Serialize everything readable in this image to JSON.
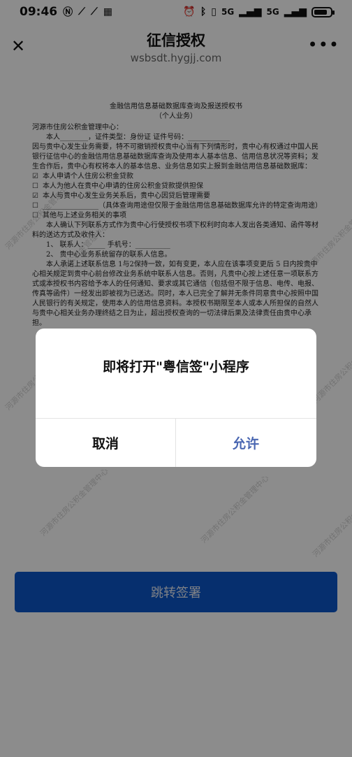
{
  "status_bar": {
    "time": "09:46",
    "left_icons": [
      "nfc-icon",
      "signal-app-icon",
      "signal-app-icon",
      "calendar-icon"
    ],
    "signal_1": "5G",
    "signal_2": "5G",
    "battery_level": 0.8
  },
  "nav": {
    "title": "征信授权",
    "url": "wsbsdt.hygjj.com"
  },
  "document": {
    "title": "金融信用信息基础数据库查询及报送授权书",
    "subtitle": "（个人业务）",
    "greeting": "河源市住房公积金管理中心：",
    "line_id": "本人________，证件类型：身份证  证件号码：____________",
    "paragraph_1": "因与贵中心发生业务需要，特不可撤销授权贵中心当有下列情形时，贵中心有权通过中国人民银行征信中心的金融信用信息基础数据库查询及使用本人基本信息、信用信息状况等资料；发生合作后，贵中心有权将本人的基本信息、业务信息如实上报到金融信用信息基础数据库：",
    "checks": [
      {
        "mark": "☑",
        "text": "本人申请个人住房公积金贷款"
      },
      {
        "mark": "☐",
        "text": "本人为他人在贵中心申请的住房公积金贷款提供担保"
      },
      {
        "mark": "☑",
        "text": "本人与贵中心发生业务关系后，贵中心因贷后管理需要"
      },
      {
        "mark": "☐",
        "text": "________________（具体查询用途但仅限于金融信用信息基础数据库允许的特定查询用途）"
      },
      {
        "mark": "☐",
        "text": "其他与上述业务相关的事项"
      }
    ],
    "paragraph_2": "本人确认下列联系方式作为贵中心行使授权书项下权利时向本人发出各类通知、函件等材料的送达方式及收件人：",
    "contact_1": "1、  联系人：_____        手机号：__________",
    "contact_2": "2、  贵中心业务系统留存的联系人信息。",
    "paragraph_3": "本人承诺上述联系信息 1与2保持一致，如有变更，本人应在该事项变更后 5 日内按贵中心相关规定到贵中心前台修改业务系统中联系人信息。否则，凡贵中心按上述任意一项联系方式或本授权书内容给予本人的任何通知、要求或其它通信（包括但不限于信息、电传、电报、传真等函件）一经发出即被视为已送达。同时，本人已完全了解并无条件同意贵中心按照中国人民银行的有关规定，使用本人的信用信息资料。本授权书期限至本人或本人所担保的自然人与贵中心相关业务办理终结之日为止，超出授权查询的一切法律后果及法律责任由贵中心承担。",
    "watermark": "河源市住房公积金管理中心"
  },
  "jump_button": "跳转签署",
  "dialog": {
    "message": "即将打开\"粤信签\"小程序",
    "cancel": "取消",
    "allow": "允许"
  }
}
